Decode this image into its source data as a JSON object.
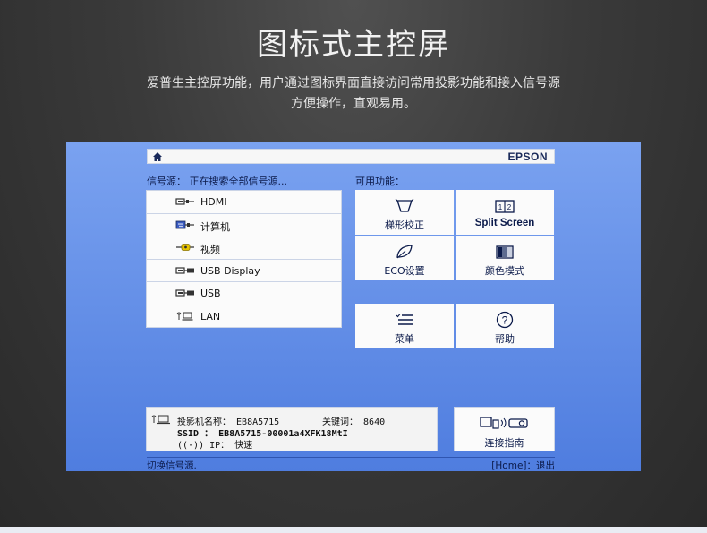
{
  "header": {
    "title": "图标式主控屏",
    "description_line1": "爱普生主控屏功能，用户通过图标界面直接访问常用投影功能和接入信号源",
    "description_line2": "方便操作，直观易用。"
  },
  "screen": {
    "brand": "EPSON",
    "source_label": "信号源： 正在搜索全部信号源...",
    "function_label": "可用功能：",
    "sources": [
      {
        "label": "HDMI",
        "icon": "hdmi-connector-icon"
      },
      {
        "label": "计算机",
        "icon": "vga-connector-icon"
      },
      {
        "label": "视频",
        "icon": "composite-video-icon"
      },
      {
        "label": "USB Display",
        "icon": "usb-display-icon"
      },
      {
        "label": "USB",
        "icon": "usb-connector-icon"
      },
      {
        "label": "LAN",
        "icon": "lan-wireless-icon"
      }
    ],
    "functions": [
      {
        "label": "梯形校正",
        "icon": "keystone-icon"
      },
      {
        "label": "Split Screen",
        "icon": "split-screen-icon"
      },
      {
        "label": "ECO设置",
        "icon": "eco-leaf-icon"
      },
      {
        "label": "颜色模式",
        "icon": "color-mode-icon"
      },
      {
        "label": "菜单",
        "icon": "menu-list-icon"
      },
      {
        "label": "帮助",
        "icon": "help-icon"
      }
    ],
    "info": {
      "projector_name_label": "投影机名称：",
      "projector_name": "EB8A5715",
      "keyword_label": "关键词：",
      "keyword": "8640",
      "ssid_label": "SSID ：",
      "ssid": "EB8A5715-00001a4XFK18MtI",
      "ip_label": "IP：",
      "ip": "快速"
    },
    "guide_label": "连接指南",
    "status_left": "切换信号源.",
    "status_right": "[Home]：退出"
  },
  "colors": {
    "page_bg": "#3a3a3a",
    "screen_top": "#7aa2f0",
    "screen_bottom": "#4f7ddf",
    "tile_bg": "#fbfbfb",
    "text_dark": "#0b1a4a"
  }
}
